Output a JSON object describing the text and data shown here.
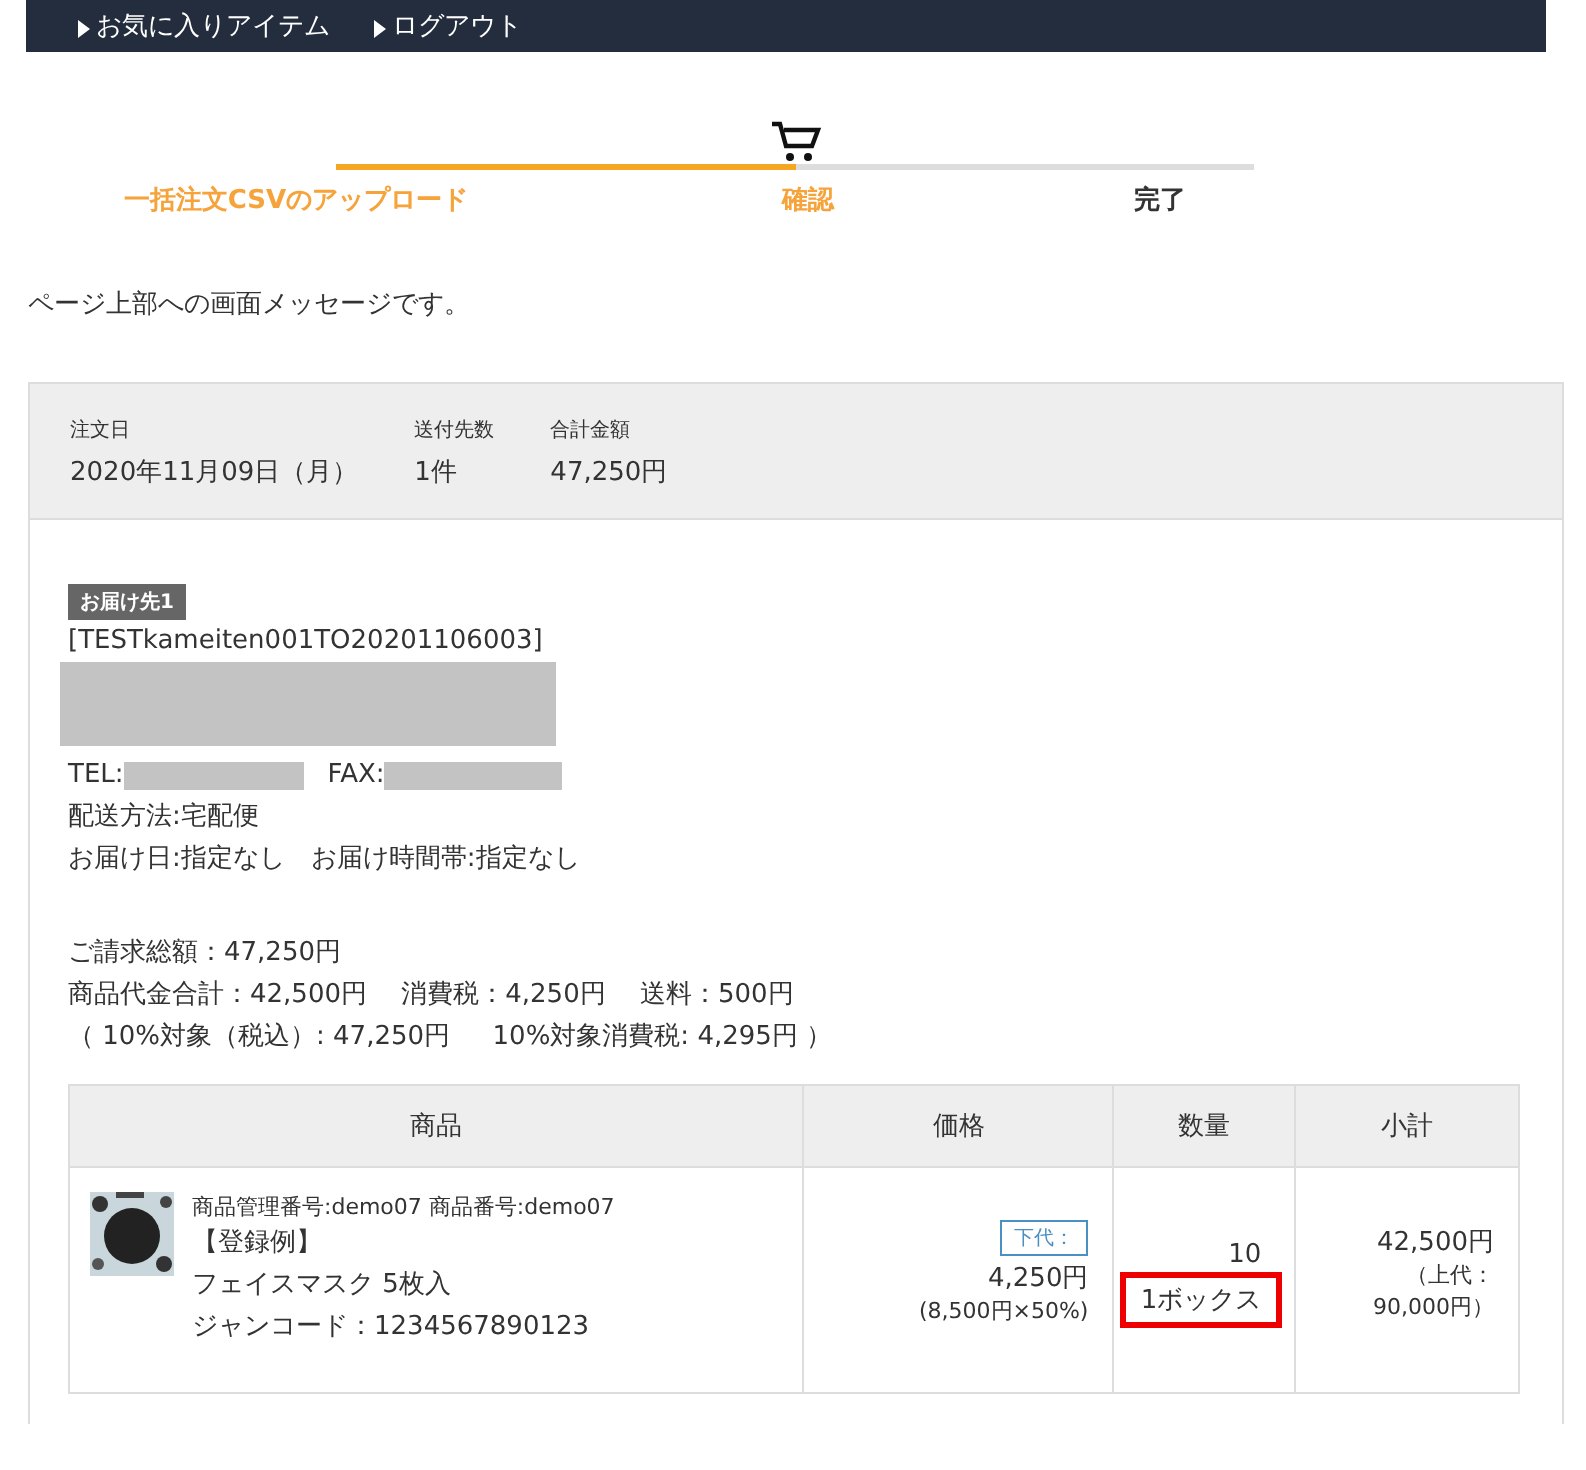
{
  "nav": {
    "links": [
      "お気に入りアイテム",
      "ログアウト"
    ]
  },
  "progress": {
    "level": 0.5,
    "steps": [
      {
        "label": "一括注文CSVのアップロード",
        "active": true
      },
      {
        "label": "確認",
        "active": true
      },
      {
        "label": "完了",
        "active": false
      }
    ]
  },
  "message": "ページ上部への画面メッセージです。",
  "summary": [
    {
      "label": "注文日",
      "value": "2020年11月09日（月）"
    },
    {
      "label": "送付先数",
      "value": "1件"
    },
    {
      "label": "合計金額",
      "value": "47,250円"
    }
  ],
  "delivery": {
    "badge": "お届け先1",
    "code": "[TESTkameiten001TO20201106003]",
    "tel_label": "TEL:",
    "fax_label": "FAX:",
    "lines": [
      "配送方法:宅配便",
      "お届け日:指定なし　お届け時間帯:指定なし"
    ]
  },
  "totals": [
    "ご請求総額：47,250円",
    "商品代金合計：42,500円　 消費税：4,250円　 送料：500円",
    "（ 10%対象（税込）: 47,250円　  10%対象消費税: 4,295円 ）"
  ],
  "table": {
    "columns": [
      "商品",
      "価格",
      "数量",
      "小計"
    ],
    "rows": [
      {
        "product": {
          "kind": "picture",
          "ids": "商品管理番号:demo07 商品番号:demo07",
          "lines": [
            "【登録例】",
            "フェイスマスク 5枚入",
            "ジャンコード：1234567890123"
          ]
        },
        "price": {
          "tag": "下代：",
          "amount": "4,250円",
          "note": "(8,500円×50%)"
        },
        "quantity": {
          "count": "10",
          "unit": "1ボックス",
          "highlighted": true
        },
        "subtotal": {
          "amount": "42,500円",
          "note": "（上代：90,000円）"
        }
      }
    ]
  }
}
